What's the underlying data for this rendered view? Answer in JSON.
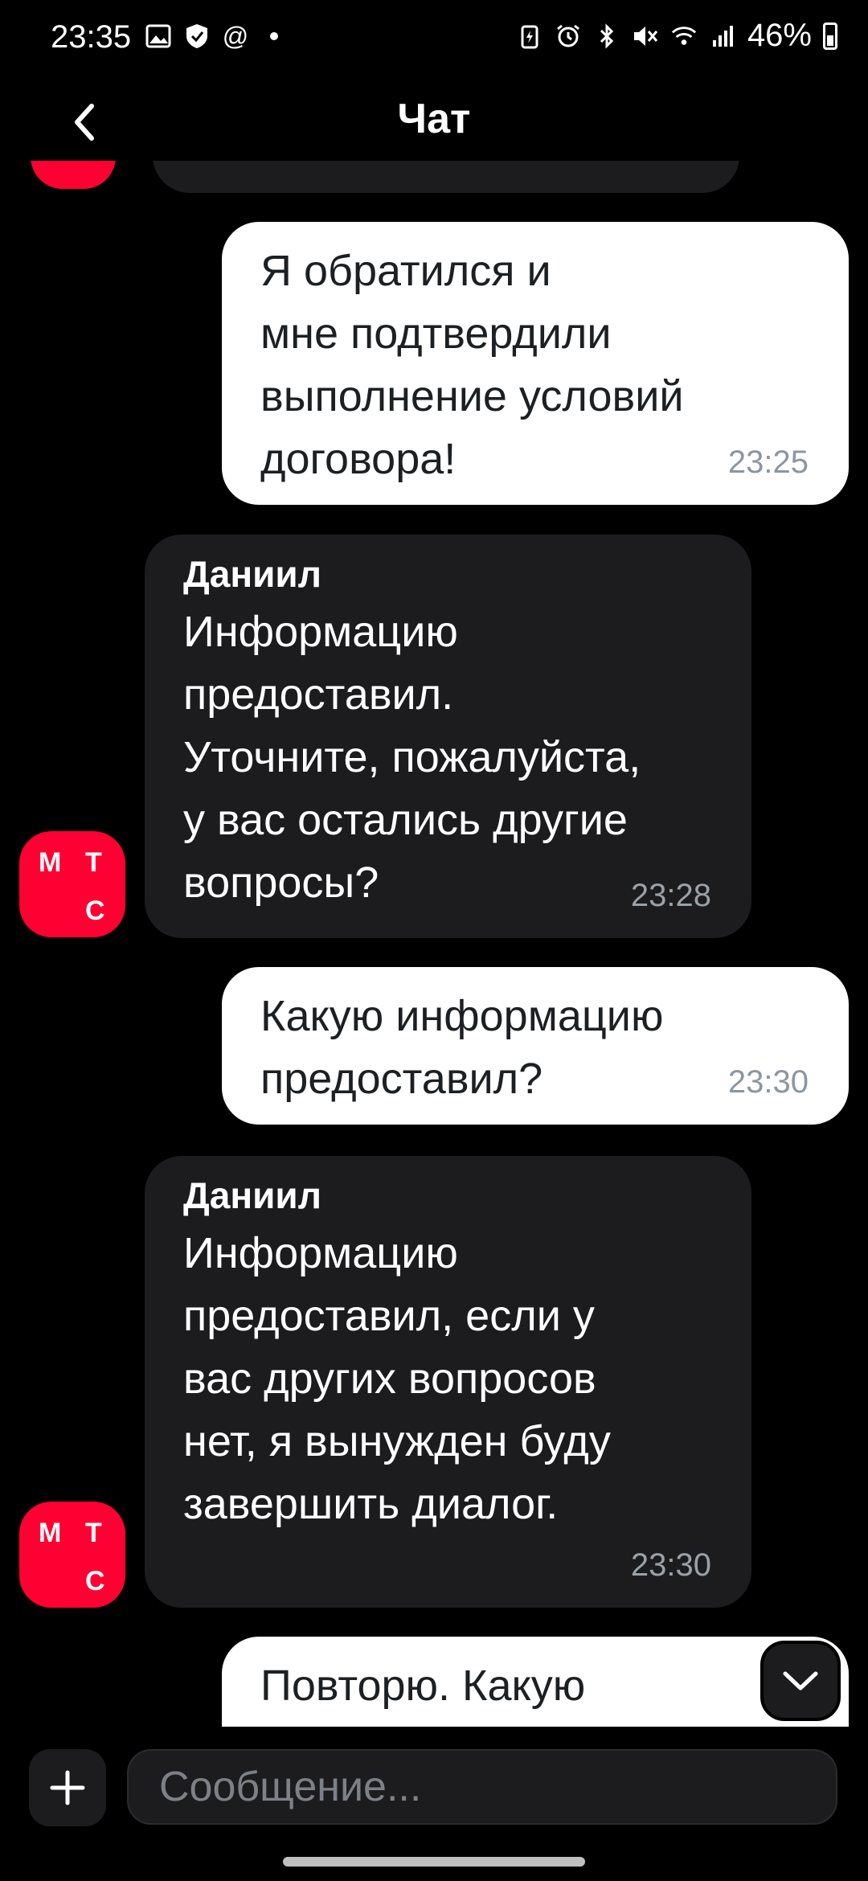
{
  "status_bar": {
    "time": "23:35",
    "battery_percent": "46%",
    "left_icons": [
      "image-icon",
      "shield-icon",
      "at-icon",
      "dot-icon"
    ],
    "right_icons": [
      "battery-saver-icon",
      "alarm-icon",
      "bluetooth-icon",
      "mute-icon",
      "wifi-icon",
      "signal-icon"
    ]
  },
  "header": {
    "title": "Чат"
  },
  "messages": [
    {
      "direction": "out",
      "text": "Я обратился и\nмне подтвердили\nвыполнение условий\nдоговора!",
      "time": "23:25"
    },
    {
      "direction": "in",
      "sender": "Даниил",
      "text": "Информацию\nпредоставил.\nУточните, пожалуйста,\nу вас остались другие\nвопросы?",
      "time": "23:28"
    },
    {
      "direction": "out",
      "text": "Какую информацию\nпредоставил?",
      "time": "23:30"
    },
    {
      "direction": "in",
      "sender": "Даниил",
      "text": "Информацию\nпредоставил, если у\nвас других вопросов\nнет, я вынужден буду\nзавершить диалог.",
      "time": "23:30"
    },
    {
      "direction": "out",
      "text": "Повторю. Какую"
    }
  ],
  "avatar": {
    "letters": [
      "М",
      "Т",
      "С"
    ],
    "color": "#ff0032"
  },
  "input": {
    "placeholder": "Сообщение..."
  },
  "colors": {
    "background": "#000000",
    "incoming_bubble": "#1c1c1e",
    "outgoing_bubble": "#ffffff",
    "brand": "#ff0032"
  }
}
